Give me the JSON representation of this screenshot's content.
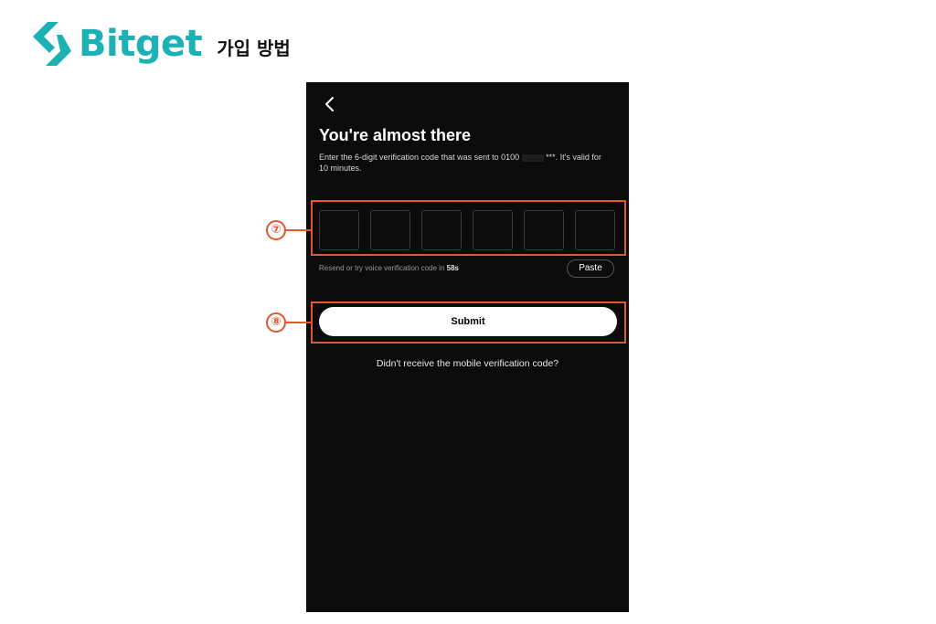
{
  "header": {
    "logo_icon": "bitget-logo-icon",
    "brand_name": "Bitget",
    "subtitle": "가입 방법",
    "brand_color": "#1cb1b5"
  },
  "screen": {
    "back_icon": "chevron-left-icon",
    "title": "You're almost there",
    "description_prefix": "Enter the 6-digit verification code that was sent to 0100",
    "description_suffix": "***. It's valid for 10 minutes.",
    "code_boxes": [
      "",
      "",
      "",
      "",
      "",
      ""
    ],
    "resend_prefix": "Resend or try voice verification code in",
    "resend_timer": "58s",
    "paste_label": "Paste",
    "submit_label": "Submit",
    "no_code_link": "Didn't receive the mobile verification code?"
  },
  "annotations": {
    "step_7": "⑦",
    "step_8": "⑧",
    "highlight_color": "#e2572e"
  }
}
